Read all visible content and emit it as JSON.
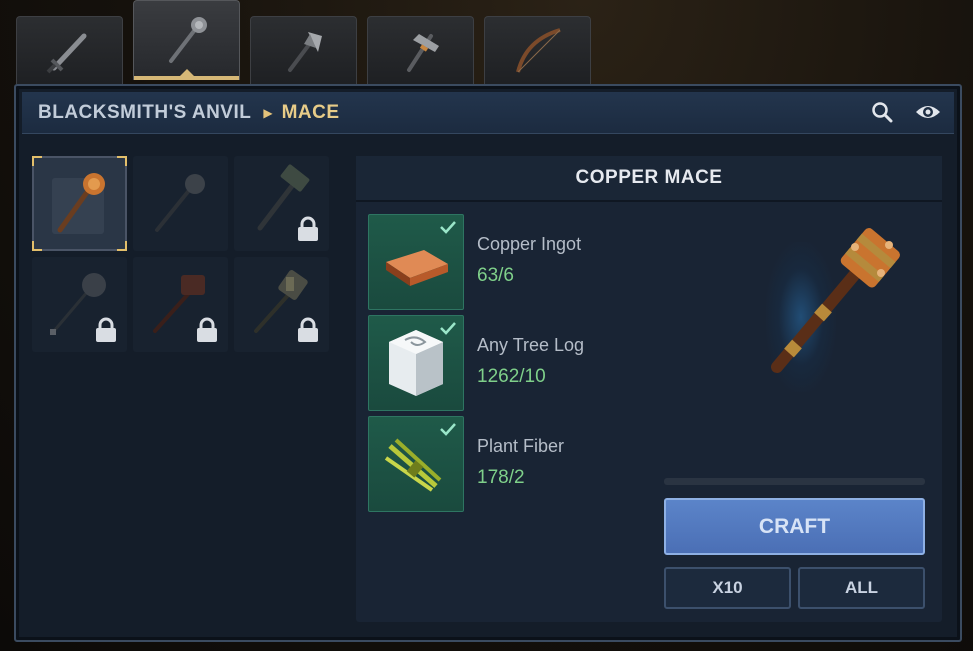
{
  "tabs": [
    {
      "name": "sword",
      "active": false
    },
    {
      "name": "mace",
      "active": true
    },
    {
      "name": "axe",
      "active": false
    },
    {
      "name": "pickaxe",
      "active": false
    },
    {
      "name": "bow",
      "active": false
    }
  ],
  "header": {
    "station": "BLACKSMITH'S ANVIL",
    "category": "MACE",
    "icons": [
      "search-icon",
      "eye-icon"
    ]
  },
  "recipes": [
    {
      "name": "copper-mace",
      "locked": false,
      "selected": true
    },
    {
      "name": "iron-mace",
      "locked": false,
      "selected": false
    },
    {
      "name": "hammer",
      "locked": true,
      "selected": false
    },
    {
      "name": "morningstar",
      "locked": true,
      "selected": false
    },
    {
      "name": "warhammer",
      "locked": true,
      "selected": false
    },
    {
      "name": "maul",
      "locked": true,
      "selected": false
    }
  ],
  "detail": {
    "title": "COPPER MACE",
    "ingredients": [
      {
        "name": "Copper Ingot",
        "count": "63/6",
        "icon": "copper-ingot-icon",
        "satisfied": true
      },
      {
        "name": "Any Tree Log",
        "count": "1262/10",
        "icon": "tree-log-icon",
        "satisfied": true
      },
      {
        "name": "Plant Fiber",
        "count": "178/2",
        "icon": "plant-fiber-icon",
        "satisfied": true
      }
    ],
    "craft_progress": 0,
    "craft_label": "CRAFT",
    "x10_label": "X10",
    "all_label": "ALL"
  },
  "colors": {
    "accent_gold": "#e3bf6b",
    "ingredient_ok": "#7fd08a",
    "craft_button": "#5b84c9"
  }
}
